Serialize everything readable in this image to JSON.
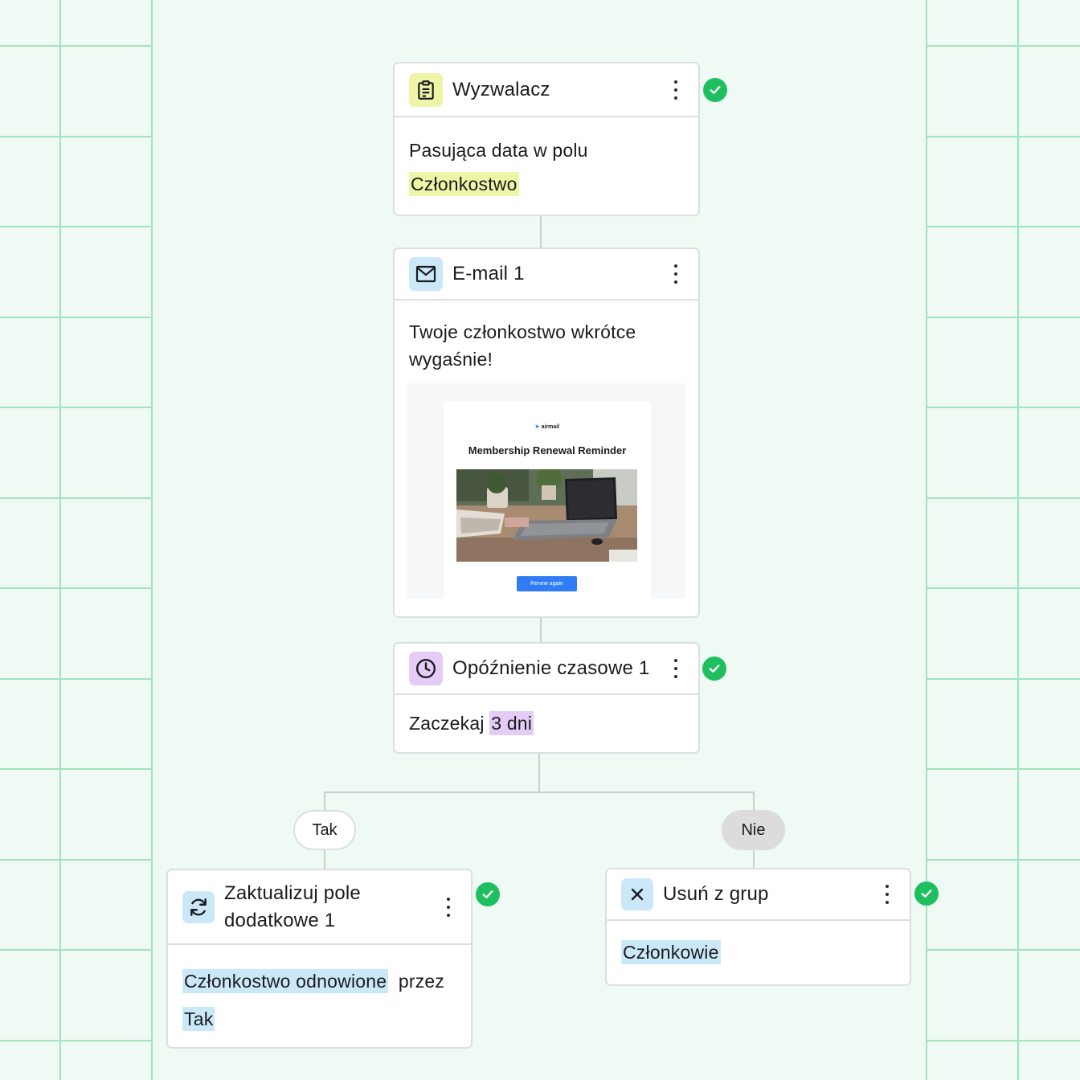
{
  "nodes": {
    "trigger": {
      "title": "Wyzwalacz",
      "body_text": "Pasująca data w polu",
      "highlight": "Członkostwo",
      "status": "done"
    },
    "email": {
      "title": "E-mail 1",
      "subject_line1": "Twoje członkostwo wkrótce",
      "subject_line2": "wygaśnie!",
      "preview": {
        "brand": "airmail",
        "heading": "Membership Renewal Reminder",
        "button_label": "Renew again"
      }
    },
    "delay": {
      "title": "Opóźnienie czasowe 1",
      "body_text": "Zaczekaj",
      "highlight": "3 dni",
      "status": "done"
    },
    "update_field": {
      "title_line1": "Zaktualizuj pole",
      "title_line2": "dodatkowe 1",
      "highlight1": "Członkostwo odnowione",
      "body_text": "przez",
      "highlight2": "Tak",
      "status": "done"
    },
    "remove_group": {
      "title": "Usuń z grup",
      "highlight": "Członkowie",
      "status": "done"
    }
  },
  "branches": {
    "yes_label": "Tak",
    "no_label": "Nie"
  },
  "colors": {
    "background": "#eefaf3",
    "grid": "#9fe3bf",
    "trigger_icon_bg": "#eef5a6",
    "email_icon_bg": "#cbe8f9",
    "delay_icon_bg": "#e4ccf7",
    "success": "#1fbf5f",
    "button_blue": "#2f7cf6"
  },
  "icons": {
    "trigger": "clipboard-icon",
    "email": "envelope-icon",
    "delay": "clock-icon",
    "update_field": "refresh-icon",
    "remove_group": "close-icon",
    "status": "check-circle-icon",
    "menu": "kebab-menu-icon"
  }
}
